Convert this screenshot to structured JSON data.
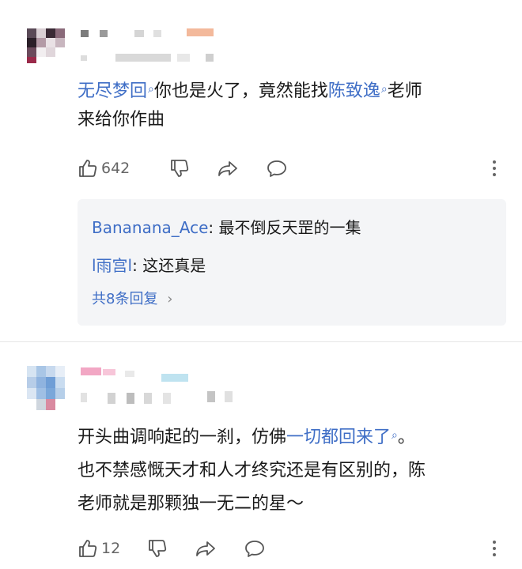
{
  "comments": [
    {
      "text_parts": [
        {
          "text": "无尽梦回",
          "link": true
        },
        {
          "text": "你也是火了，竟然能找",
          "link": false
        },
        {
          "text": "陈致逸",
          "link": true
        },
        {
          "text": "老师",
          "link": false
        }
      ],
      "text_line2": "来给你作曲",
      "likes": "642",
      "replies": [
        {
          "author": "Bananana_Ace",
          "text": "最不倒反天罡的一集"
        },
        {
          "author": "l雨宫l",
          "text": "这还真是"
        }
      ],
      "reply_more": "共8条回复",
      "colors": {
        "link": "#3f6ec6"
      }
    },
    {
      "line1_a": "开头曲调响起的一刹，仿佛",
      "line1_link": "一切都回来了",
      "line1_b": "。",
      "line2": "也不禁感慨天才和人才终究还是有区别的，陈",
      "line3": "老师就是那颗独一无二的星～",
      "likes": "12"
    }
  ],
  "punct": {
    "colon": ": ",
    "chevron": "›"
  },
  "icons": [
    "thumbs-up-icon",
    "thumbs-down-icon",
    "share-icon",
    "comment-bubble-icon",
    "more-vertical-icon",
    "search-mini-icon"
  ]
}
